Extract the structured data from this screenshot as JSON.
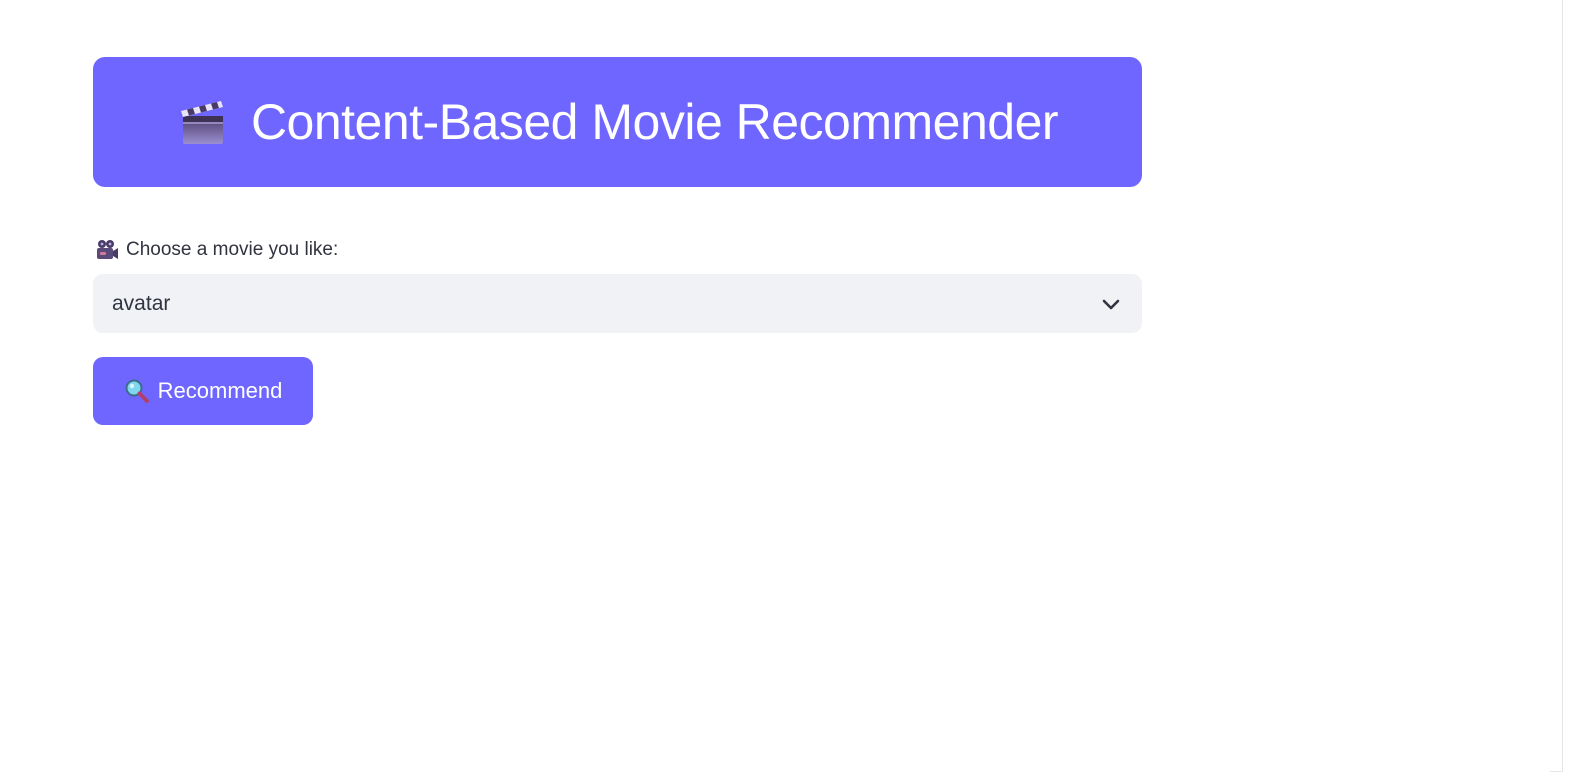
{
  "header": {
    "icon": "clapper-board-icon",
    "title": "Content-Based Movie Recommender",
    "background_color": "#6e66ff"
  },
  "movie_select": {
    "label_icon": "movie-camera-icon",
    "label": "Choose a movie you like:",
    "selected_value": "avatar",
    "background_color": "#f0f2f6"
  },
  "recommend_button": {
    "icon": "magnifier-icon",
    "label": "Recommend",
    "background_color": "#6e66ff"
  }
}
